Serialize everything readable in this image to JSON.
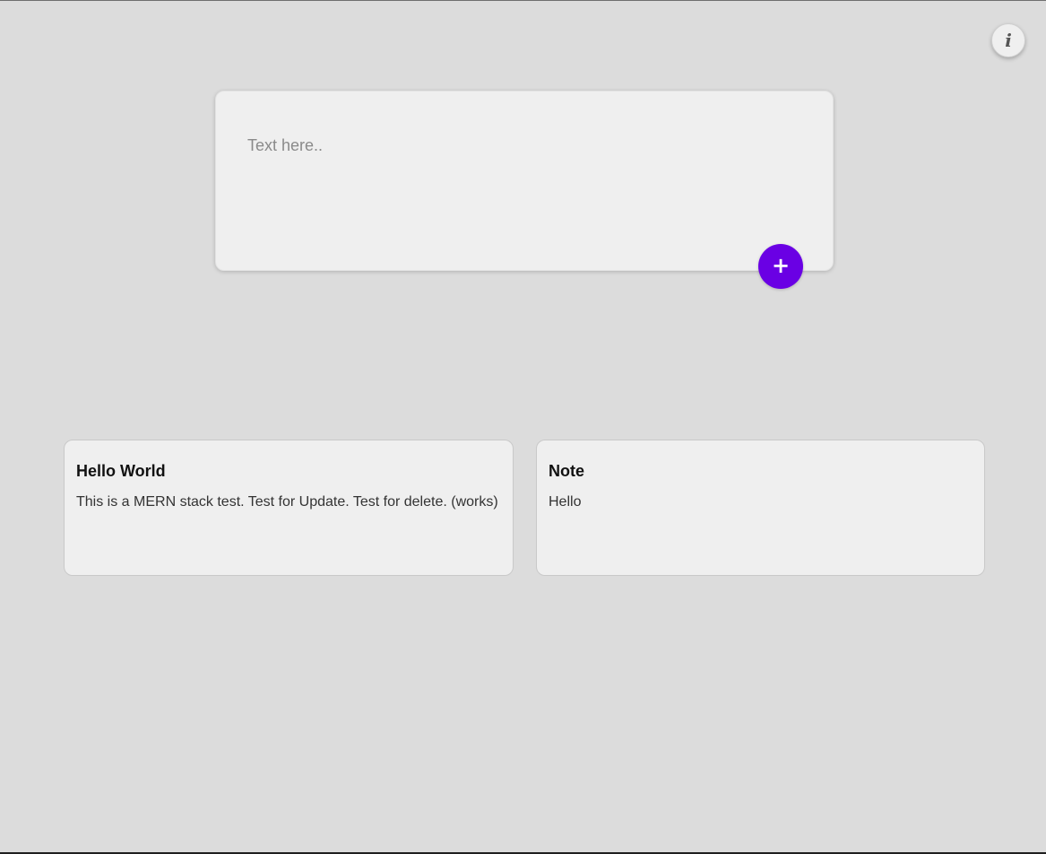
{
  "info_button": {
    "glyph": "i",
    "icon": "info-icon"
  },
  "composer": {
    "placeholder": "Text here..",
    "value": "",
    "add_button": {
      "glyph": "+",
      "icon": "plus-icon",
      "color": "#6a00e4"
    }
  },
  "notes": [
    {
      "title": "Hello World",
      "body": "This is a MERN stack test. Test for Update. Test for delete. (works)"
    },
    {
      "title": "Note",
      "body": "Hello"
    }
  ],
  "colors": {
    "background": "#dcdcdc",
    "card": "#efefef",
    "accent": "#6a00e4"
  }
}
